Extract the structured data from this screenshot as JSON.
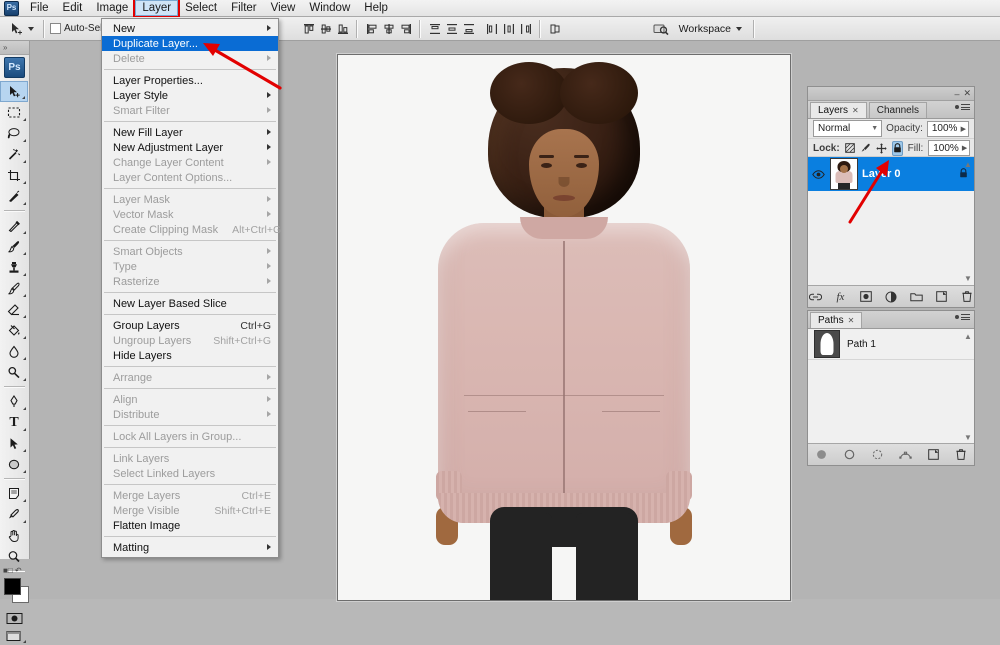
{
  "app": {
    "name": "Adobe Photoshop",
    "logo_text": "Ps",
    "accent_blue": "#0a6cd4",
    "highlight_red": "#e20000",
    "layer_select_blue": "#0a7fe0"
  },
  "menubar": {
    "items": [
      {
        "label": "File",
        "active": false
      },
      {
        "label": "Edit",
        "active": false
      },
      {
        "label": "Image",
        "active": false
      },
      {
        "label": "Layer",
        "active": true
      },
      {
        "label": "Select",
        "active": false
      },
      {
        "label": "Filter",
        "active": false
      },
      {
        "label": "View",
        "active": false
      },
      {
        "label": "Window",
        "active": false
      },
      {
        "label": "Help",
        "active": false
      }
    ]
  },
  "options_bar": {
    "tool_icon": "move-tool-icon",
    "auto_select_label": "Auto-Select:",
    "auto_select_checked": false,
    "align_icons": [
      "align-top-edges-icon",
      "align-vertical-centers-icon",
      "align-bottom-edges-icon",
      "align-left-edges-icon",
      "align-horizontal-centers-icon",
      "align-right-edges-icon"
    ],
    "distribute_icons": [
      "distribute-top-edges-icon",
      "distribute-vertical-centers-icon",
      "distribute-bottom-edges-icon",
      "distribute-left-edges-icon",
      "distribute-horizontal-centers-icon",
      "distribute-right-edges-icon"
    ],
    "extra_icon": "auto-align-layers-icon",
    "bridge_icon": "launch-bridge-icon",
    "workspace_label": "Workspace"
  },
  "toolbox": {
    "logo_text": "Ps",
    "tools": [
      {
        "name": "move-tool",
        "selected": true,
        "has_flyout": true
      },
      {
        "name": "rectangular-marquee-tool",
        "selected": false,
        "has_flyout": true
      },
      {
        "name": "lasso-tool",
        "selected": false,
        "has_flyout": true
      },
      {
        "name": "magic-wand-tool",
        "selected": false,
        "has_flyout": true
      },
      {
        "name": "crop-tool",
        "selected": false,
        "has_flyout": true
      },
      {
        "name": "eyedropper-slice-tool",
        "selected": false,
        "has_flyout": true
      },
      {
        "name": "healing-brush-tool",
        "selected": false,
        "has_flyout": true
      },
      {
        "name": "brush-tool",
        "selected": false,
        "has_flyout": true
      },
      {
        "name": "clone-stamp-tool",
        "selected": false,
        "has_flyout": true
      },
      {
        "name": "history-brush-tool",
        "selected": false,
        "has_flyout": true
      },
      {
        "name": "eraser-tool",
        "selected": false,
        "has_flyout": true
      },
      {
        "name": "gradient-tool",
        "selected": false,
        "has_flyout": true
      },
      {
        "name": "blur-tool",
        "selected": false,
        "has_flyout": true
      },
      {
        "name": "dodge-tool",
        "selected": false,
        "has_flyout": true
      },
      {
        "name": "pen-tool",
        "selected": false,
        "has_flyout": true
      },
      {
        "name": "horizontal-type-tool",
        "selected": false,
        "has_flyout": true
      },
      {
        "name": "path-selection-tool",
        "selected": false,
        "has_flyout": true
      },
      {
        "name": "ellipse-shape-tool",
        "selected": false,
        "has_flyout": true
      },
      {
        "name": "notes-tool",
        "selected": false,
        "has_flyout": true
      },
      {
        "name": "color-sampler-tool",
        "selected": false,
        "has_flyout": true
      },
      {
        "name": "hand-tool",
        "selected": false,
        "has_flyout": false
      },
      {
        "name": "zoom-tool",
        "selected": false,
        "has_flyout": false
      }
    ],
    "foreground_color": "#000000",
    "background_color": "#ffffff",
    "quick_mask_icon": "quick-mask-icon",
    "screen_mode_icon": "screen-mode-icon"
  },
  "layer_menu": {
    "title": "Layer",
    "items": [
      {
        "label": "New",
        "shortcut": "",
        "submenu": true,
        "disabled": false,
        "highlighted": false
      },
      {
        "label": "Duplicate Layer...",
        "shortcut": "",
        "submenu": false,
        "disabled": false,
        "highlighted": true
      },
      {
        "label": "Delete",
        "shortcut": "",
        "submenu": true,
        "disabled": true,
        "highlighted": false
      },
      {
        "separator": true
      },
      {
        "label": "Layer Properties...",
        "shortcut": "",
        "submenu": false,
        "disabled": false,
        "highlighted": false
      },
      {
        "label": "Layer Style",
        "shortcut": "",
        "submenu": true,
        "disabled": false,
        "highlighted": false
      },
      {
        "label": "Smart Filter",
        "shortcut": "",
        "submenu": true,
        "disabled": true,
        "highlighted": false
      },
      {
        "separator": true
      },
      {
        "label": "New Fill Layer",
        "shortcut": "",
        "submenu": true,
        "disabled": false,
        "highlighted": false
      },
      {
        "label": "New Adjustment Layer",
        "shortcut": "",
        "submenu": true,
        "disabled": false,
        "highlighted": false
      },
      {
        "label": "Change Layer Content",
        "shortcut": "",
        "submenu": true,
        "disabled": true,
        "highlighted": false
      },
      {
        "label": "Layer Content Options...",
        "shortcut": "",
        "submenu": false,
        "disabled": true,
        "highlighted": false
      },
      {
        "separator": true
      },
      {
        "label": "Layer Mask",
        "shortcut": "",
        "submenu": true,
        "disabled": true,
        "highlighted": false
      },
      {
        "label": "Vector Mask",
        "shortcut": "",
        "submenu": true,
        "disabled": true,
        "highlighted": false
      },
      {
        "label": "Create Clipping Mask",
        "shortcut": "Alt+Ctrl+G",
        "submenu": false,
        "disabled": true,
        "highlighted": false
      },
      {
        "separator": true
      },
      {
        "label": "Smart Objects",
        "shortcut": "",
        "submenu": true,
        "disabled": true,
        "highlighted": false
      },
      {
        "label": "Type",
        "shortcut": "",
        "submenu": true,
        "disabled": true,
        "highlighted": false
      },
      {
        "label": "Rasterize",
        "shortcut": "",
        "submenu": true,
        "disabled": true,
        "highlighted": false
      },
      {
        "separator": true
      },
      {
        "label": "New Layer Based Slice",
        "shortcut": "",
        "submenu": false,
        "disabled": false,
        "highlighted": false
      },
      {
        "separator": true
      },
      {
        "label": "Group Layers",
        "shortcut": "Ctrl+G",
        "submenu": false,
        "disabled": false,
        "highlighted": false
      },
      {
        "label": "Ungroup Layers",
        "shortcut": "Shift+Ctrl+G",
        "submenu": false,
        "disabled": true,
        "highlighted": false
      },
      {
        "label": "Hide Layers",
        "shortcut": "",
        "submenu": false,
        "disabled": false,
        "highlighted": false
      },
      {
        "separator": true
      },
      {
        "label": "Arrange",
        "shortcut": "",
        "submenu": true,
        "disabled": true,
        "highlighted": false
      },
      {
        "separator": true
      },
      {
        "label": "Align",
        "shortcut": "",
        "submenu": true,
        "disabled": true,
        "highlighted": false
      },
      {
        "label": "Distribute",
        "shortcut": "",
        "submenu": true,
        "disabled": true,
        "highlighted": false
      },
      {
        "separator": true
      },
      {
        "label": "Lock All Layers in Group...",
        "shortcut": "",
        "submenu": false,
        "disabled": true,
        "highlighted": false
      },
      {
        "separator": true
      },
      {
        "label": "Link Layers",
        "shortcut": "",
        "submenu": false,
        "disabled": true,
        "highlighted": false
      },
      {
        "label": "Select Linked Layers",
        "shortcut": "",
        "submenu": false,
        "disabled": true,
        "highlighted": false
      },
      {
        "separator": true
      },
      {
        "label": "Merge Layers",
        "shortcut": "Ctrl+E",
        "submenu": false,
        "disabled": true,
        "highlighted": false
      },
      {
        "label": "Merge Visible",
        "shortcut": "Shift+Ctrl+E",
        "submenu": false,
        "disabled": true,
        "highlighted": false
      },
      {
        "label": "Flatten Image",
        "shortcut": "",
        "submenu": false,
        "disabled": false,
        "highlighted": false
      },
      {
        "separator": true
      },
      {
        "label": "Matting",
        "shortcut": "",
        "submenu": true,
        "disabled": false,
        "highlighted": false
      }
    ]
  },
  "layers_panel": {
    "tabs": [
      {
        "label": "Layers",
        "closable": true,
        "active": true
      },
      {
        "label": "Channels",
        "closable": false,
        "active": false
      }
    ],
    "blend_mode": "Normal",
    "opacity_label": "Opacity:",
    "opacity_value": "100%",
    "lock_label": "Lock:",
    "lock_icons": [
      {
        "name": "lock-transparent-pixels-icon",
        "on": false
      },
      {
        "name": "lock-image-pixels-icon",
        "on": false
      },
      {
        "name": "lock-position-icon",
        "on": false
      },
      {
        "name": "lock-all-icon",
        "on": true
      }
    ],
    "fill_label": "Fill:",
    "fill_value": "100%",
    "layers": [
      {
        "name": "Layer 0",
        "visible": true,
        "locked": true,
        "selected": true,
        "thumbnail": "woman-photo-thumbnail"
      }
    ],
    "footer_icons": [
      "link-layers-icon",
      "add-layer-style-icon",
      "add-layer-mask-icon",
      "new-adjustment-layer-icon",
      "new-group-icon",
      "new-layer-icon",
      "delete-layer-icon"
    ]
  },
  "paths_panel": {
    "tabs": [
      {
        "label": "Paths",
        "closable": true,
        "active": true
      }
    ],
    "paths": [
      {
        "name": "Path 1",
        "thumbnail": "silhouette-path-thumbnail"
      }
    ],
    "footer_icons": [
      "fill-path-icon",
      "stroke-path-icon",
      "load-path-as-selection-icon",
      "make-work-path-icon",
      "new-path-icon",
      "delete-path-icon"
    ]
  },
  "canvas": {
    "document_content": "woman-in-pink-bomber-jacket-photo",
    "background": "#f7f7f6"
  },
  "annotations": [
    {
      "name": "arrow-to-duplicate-layer",
      "color": "#e20000"
    },
    {
      "name": "arrow-to-layer-0",
      "color": "#e20000"
    },
    {
      "name": "highlight-box-layer-menu",
      "color": "#e20000"
    }
  ]
}
